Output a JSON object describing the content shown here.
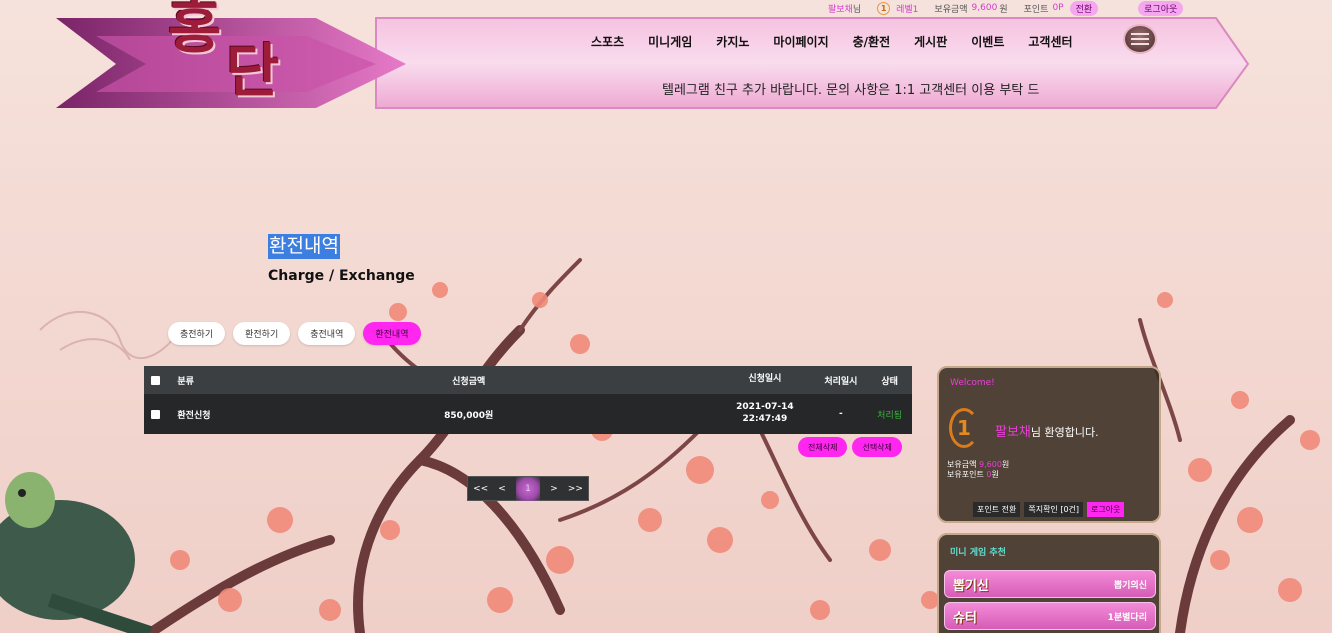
{
  "userbar": {
    "username": "팔보채",
    "username_suffix": "님",
    "level_num": "1",
    "level_label": "레벨1",
    "balance_label": "보유금액",
    "balance_value": "9,600",
    "balance_unit": "원",
    "point_label": "포인트",
    "point_value": "0P",
    "convert_label": "전환",
    "logout_label": "로그아웃"
  },
  "logo": {
    "line1": "홍",
    "line2": "단"
  },
  "nav": [
    "스포츠",
    "미니게임",
    "카지노",
    "마이페이지",
    "충/환전",
    "게시판",
    "이벤트",
    "고객센터"
  ],
  "ticker": "텔레그램 친구 추가 바랍니다. 문의 사항은 1:1 고객센터 이용 부탁 드",
  "page": {
    "title": "환전내역",
    "subtitle": "Charge / Exchange"
  },
  "tabs": [
    {
      "label": "충전하기",
      "active": false
    },
    {
      "label": "환전하기",
      "active": false
    },
    {
      "label": "충전내역",
      "active": false
    },
    {
      "label": "환전내역",
      "active": true
    }
  ],
  "table": {
    "headers": {
      "category": "분류",
      "amount": "신청금액",
      "requested": "신청일시",
      "processed": "처리일시",
      "status": "상태"
    },
    "rows": [
      {
        "category": "환전신청",
        "amount": "850,000원",
        "req_date": "2021-07-14",
        "req_time": "22:47:49",
        "processed": "-",
        "status": "처리됨"
      }
    ]
  },
  "actions": {
    "delete_all": "전체삭제",
    "delete_selected": "선택삭제"
  },
  "pager": {
    "first": "<<",
    "prev": "<",
    "current": "1",
    "next": ">",
    "last": ">>"
  },
  "welcome": {
    "title": "Welcome!",
    "level_num": "1",
    "name": "팔보채",
    "greeting_suffix": "님 환영합니다.",
    "balance_label": "보유금액",
    "balance_value": "9,600",
    "balance_unit": "원",
    "point_label": "보유포인트",
    "point_value": "0",
    "point_unit": "원",
    "btn_point": "포인트 전환",
    "btn_message": "쪽지확인 [0건]",
    "btn_logout": "로그아웃"
  },
  "minigame": {
    "title": "미니 게임 추천",
    "items": [
      {
        "logo": "뽑기신",
        "name": "뽑기의신"
      },
      {
        "logo": "슈터",
        "name": "1분별다리"
      }
    ]
  },
  "colors": {
    "accent": "#ff26ef",
    "brand": "#9c1c3a",
    "table_dark": "#252729"
  }
}
